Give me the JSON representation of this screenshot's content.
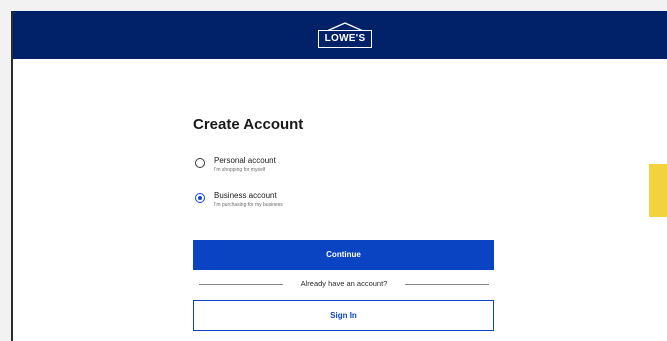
{
  "header": {
    "logo_text": "LOWE'S",
    "background_color": "#012169"
  },
  "form": {
    "title": "Create Account",
    "options": [
      {
        "label": "Personal account",
        "sublabel": "I'm shopping for myself",
        "selected": false
      },
      {
        "label": "Business account",
        "sublabel": "I'm purchasing for my business",
        "selected": true
      }
    ],
    "continue_label": "Continue",
    "divider_text": "Already have an account?",
    "signin_label": "Sign In"
  },
  "colors": {
    "primary_button": "#0a44c2",
    "accent_tab": "#f2d23f"
  }
}
